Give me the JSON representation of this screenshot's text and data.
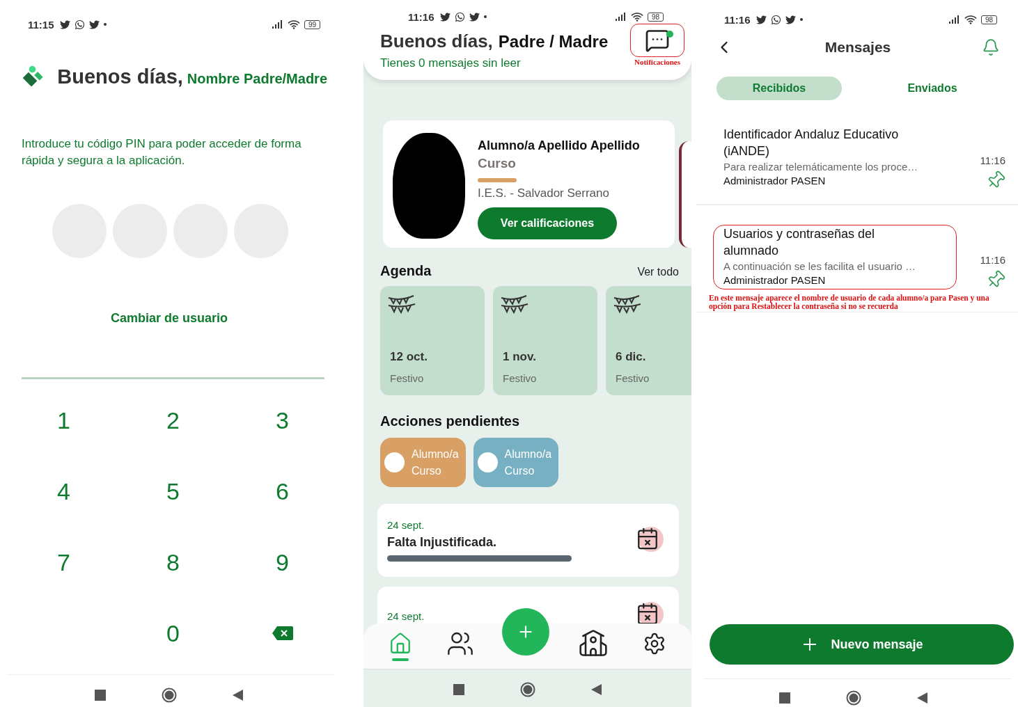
{
  "pin_screen": {
    "status_bar": {
      "time": "11:15",
      "battery": "99"
    },
    "greeting": "Buenos días,",
    "user_name": "Nombre Padre/Madre",
    "instructions": "Introduce tu código PIN para poder acceder de forma rápida y segura a la aplicación.",
    "pin_dots": [
      {
        "filled": false
      },
      {
        "filled": false
      },
      {
        "filled": false
      },
      {
        "filled": false
      }
    ],
    "switch_user": "Cambiar de usuario",
    "keypad": [
      {
        "kind": "digit",
        "label": "1"
      },
      {
        "kind": "digit",
        "label": "2"
      },
      {
        "kind": "digit",
        "label": "3"
      },
      {
        "kind": "digit",
        "label": "4"
      },
      {
        "kind": "digit",
        "label": "5"
      },
      {
        "kind": "digit",
        "label": "6"
      },
      {
        "kind": "digit",
        "label": "7"
      },
      {
        "kind": "digit",
        "label": "8"
      },
      {
        "kind": "digit",
        "label": "9"
      },
      {
        "kind": "blank"
      },
      {
        "kind": "digit",
        "label": "0"
      },
      {
        "kind": "backspace"
      }
    ]
  },
  "home_screen": {
    "status_bar": {
      "time": "11:16",
      "battery": "98"
    },
    "greeting": "Buenos días,",
    "user_name": "Padre / Madre",
    "unread": "Tienes 0 mensajes sin leer",
    "notifications": {
      "has_new": true,
      "highlighted": true,
      "annotation": "Notificaciones"
    },
    "student": {
      "name": "Alumno/a Apellido Apellido",
      "course": "Curso",
      "school": "I.E.S. - Salvador Serrano",
      "button": "Ver calificaciones"
    },
    "agenda": {
      "title": "Agenda",
      "see_all": "Ver todo",
      "items": [
        {
          "date": "12 oct.",
          "type": "Festivo"
        },
        {
          "date": "1 nov.",
          "type": "Festivo"
        },
        {
          "date": "6 dic.",
          "type": "Festivo"
        }
      ]
    },
    "pending": {
      "title": "Acciones pendientes",
      "items": [
        {
          "name": "Alumno/a",
          "course": "Curso",
          "color": "#d9a066"
        },
        {
          "name": "Alumno/a",
          "course": "Curso",
          "color": "#77b0c2"
        }
      ]
    },
    "events": [
      {
        "date": "24 sept.",
        "title": "Falta Injustificada."
      },
      {
        "date": "24 sept."
      }
    ],
    "nav": [
      {
        "kind": "home",
        "selected": true
      },
      {
        "kind": "people",
        "selected": false
      },
      {
        "kind": "school",
        "selected": false
      },
      {
        "kind": "settings",
        "selected": false
      }
    ]
  },
  "messages_screen": {
    "status_bar": {
      "time": "11:16",
      "battery": "98"
    },
    "title": "Mensajes",
    "tabs": [
      {
        "label": "Recibidos",
        "selected": true
      },
      {
        "label": "Enviados",
        "selected": false
      }
    ],
    "messages": [
      {
        "subject": "Identificador Andaluz Educativo (iANDE)",
        "preview": "Para realizar telemáticamente los proce…",
        "sender": "Administrador PASEN",
        "time": "11:16",
        "highlighted": false
      },
      {
        "subject": "Usuarios y contraseñas del alumnado",
        "preview": "A continuación se les facilita el usuario …",
        "sender": "Administrador PASEN",
        "time": "11:16",
        "highlighted": true,
        "annotation": "En este mensaje aparece el nombre de usuario de cada alumno/a para Pasen y una opción para Restablecer la contraseña si no se recuerda"
      }
    ],
    "new_message": "Nuevo mensaje"
  }
}
